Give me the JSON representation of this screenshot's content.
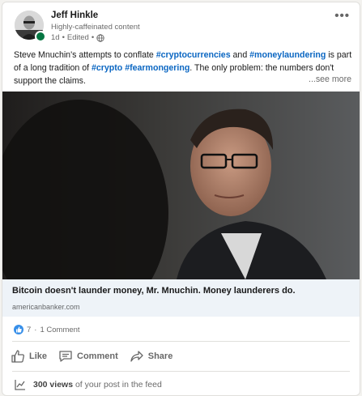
{
  "author": {
    "name": "Jeff Hinkle",
    "headline": "Highly-caffeinated content",
    "age": "1d",
    "edited": "Edited",
    "separator": "•"
  },
  "post": {
    "segments": [
      {
        "text": "Steve Mnuchin's attempts to conflate ",
        "tag": false
      },
      {
        "text": "#cryptocurrencies",
        "tag": true
      },
      {
        "text": " and ",
        "tag": false
      },
      {
        "text": "#moneylaundering",
        "tag": true
      },
      {
        "text": " is part of a long tradition of ",
        "tag": false
      },
      {
        "text": "#crypto",
        "tag": true
      },
      {
        "text": " ",
        "tag": false
      },
      {
        "text": "#fearmongering",
        "tag": true
      },
      {
        "text": ". The only problem: the numbers don't support the claims.",
        "tag": false
      }
    ],
    "see_more": "...see more"
  },
  "link": {
    "title": "Bitcoin doesn't launder money, Mr. Mnuchin. Money launderers do.",
    "domain": "americanbanker.com"
  },
  "social": {
    "reactions": "7",
    "separator": "·",
    "comments": "1 Comment"
  },
  "actions": {
    "like": "Like",
    "comment": "Comment",
    "share": "Share"
  },
  "views": {
    "count": "300 views",
    "suffix": "of your post in the feed"
  },
  "colors": {
    "link_blue": "#0a66c2",
    "presence_green": "#057642",
    "link_box_bg": "#eef3f8"
  },
  "icons": [
    "more-options-icon",
    "globe-icon",
    "like-reaction-icon",
    "like-icon",
    "comment-icon",
    "share-icon",
    "analytics-icon"
  ]
}
